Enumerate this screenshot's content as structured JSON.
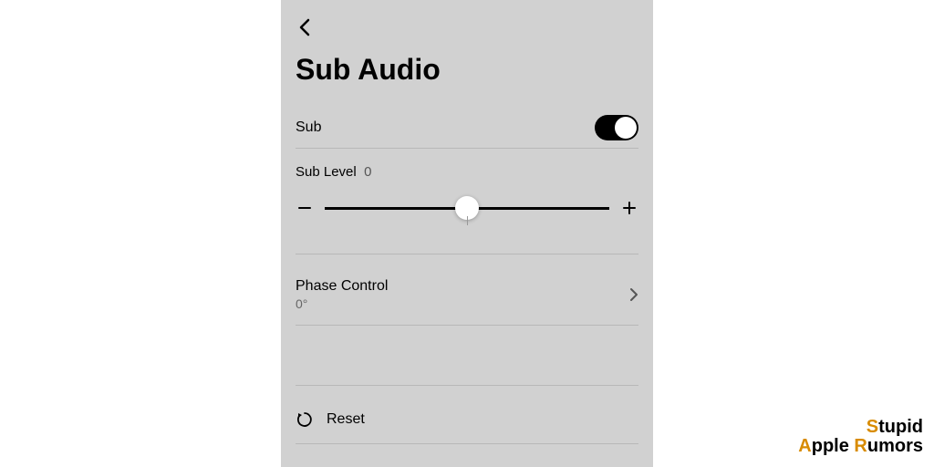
{
  "page": {
    "title": "Sub Audio"
  },
  "sub_toggle": {
    "label": "Sub",
    "on": true
  },
  "sub_level": {
    "label": "Sub Level",
    "value": "0"
  },
  "phase_control": {
    "label": "Phase Control",
    "value": "0°"
  },
  "reset": {
    "label": "Reset"
  },
  "watermark": {
    "line1_accent": "S",
    "line1_rest": "tupid",
    "line2_accent1": "A",
    "line2_mid": "pple ",
    "line2_accent2": "R",
    "line2_rest": "umors"
  }
}
